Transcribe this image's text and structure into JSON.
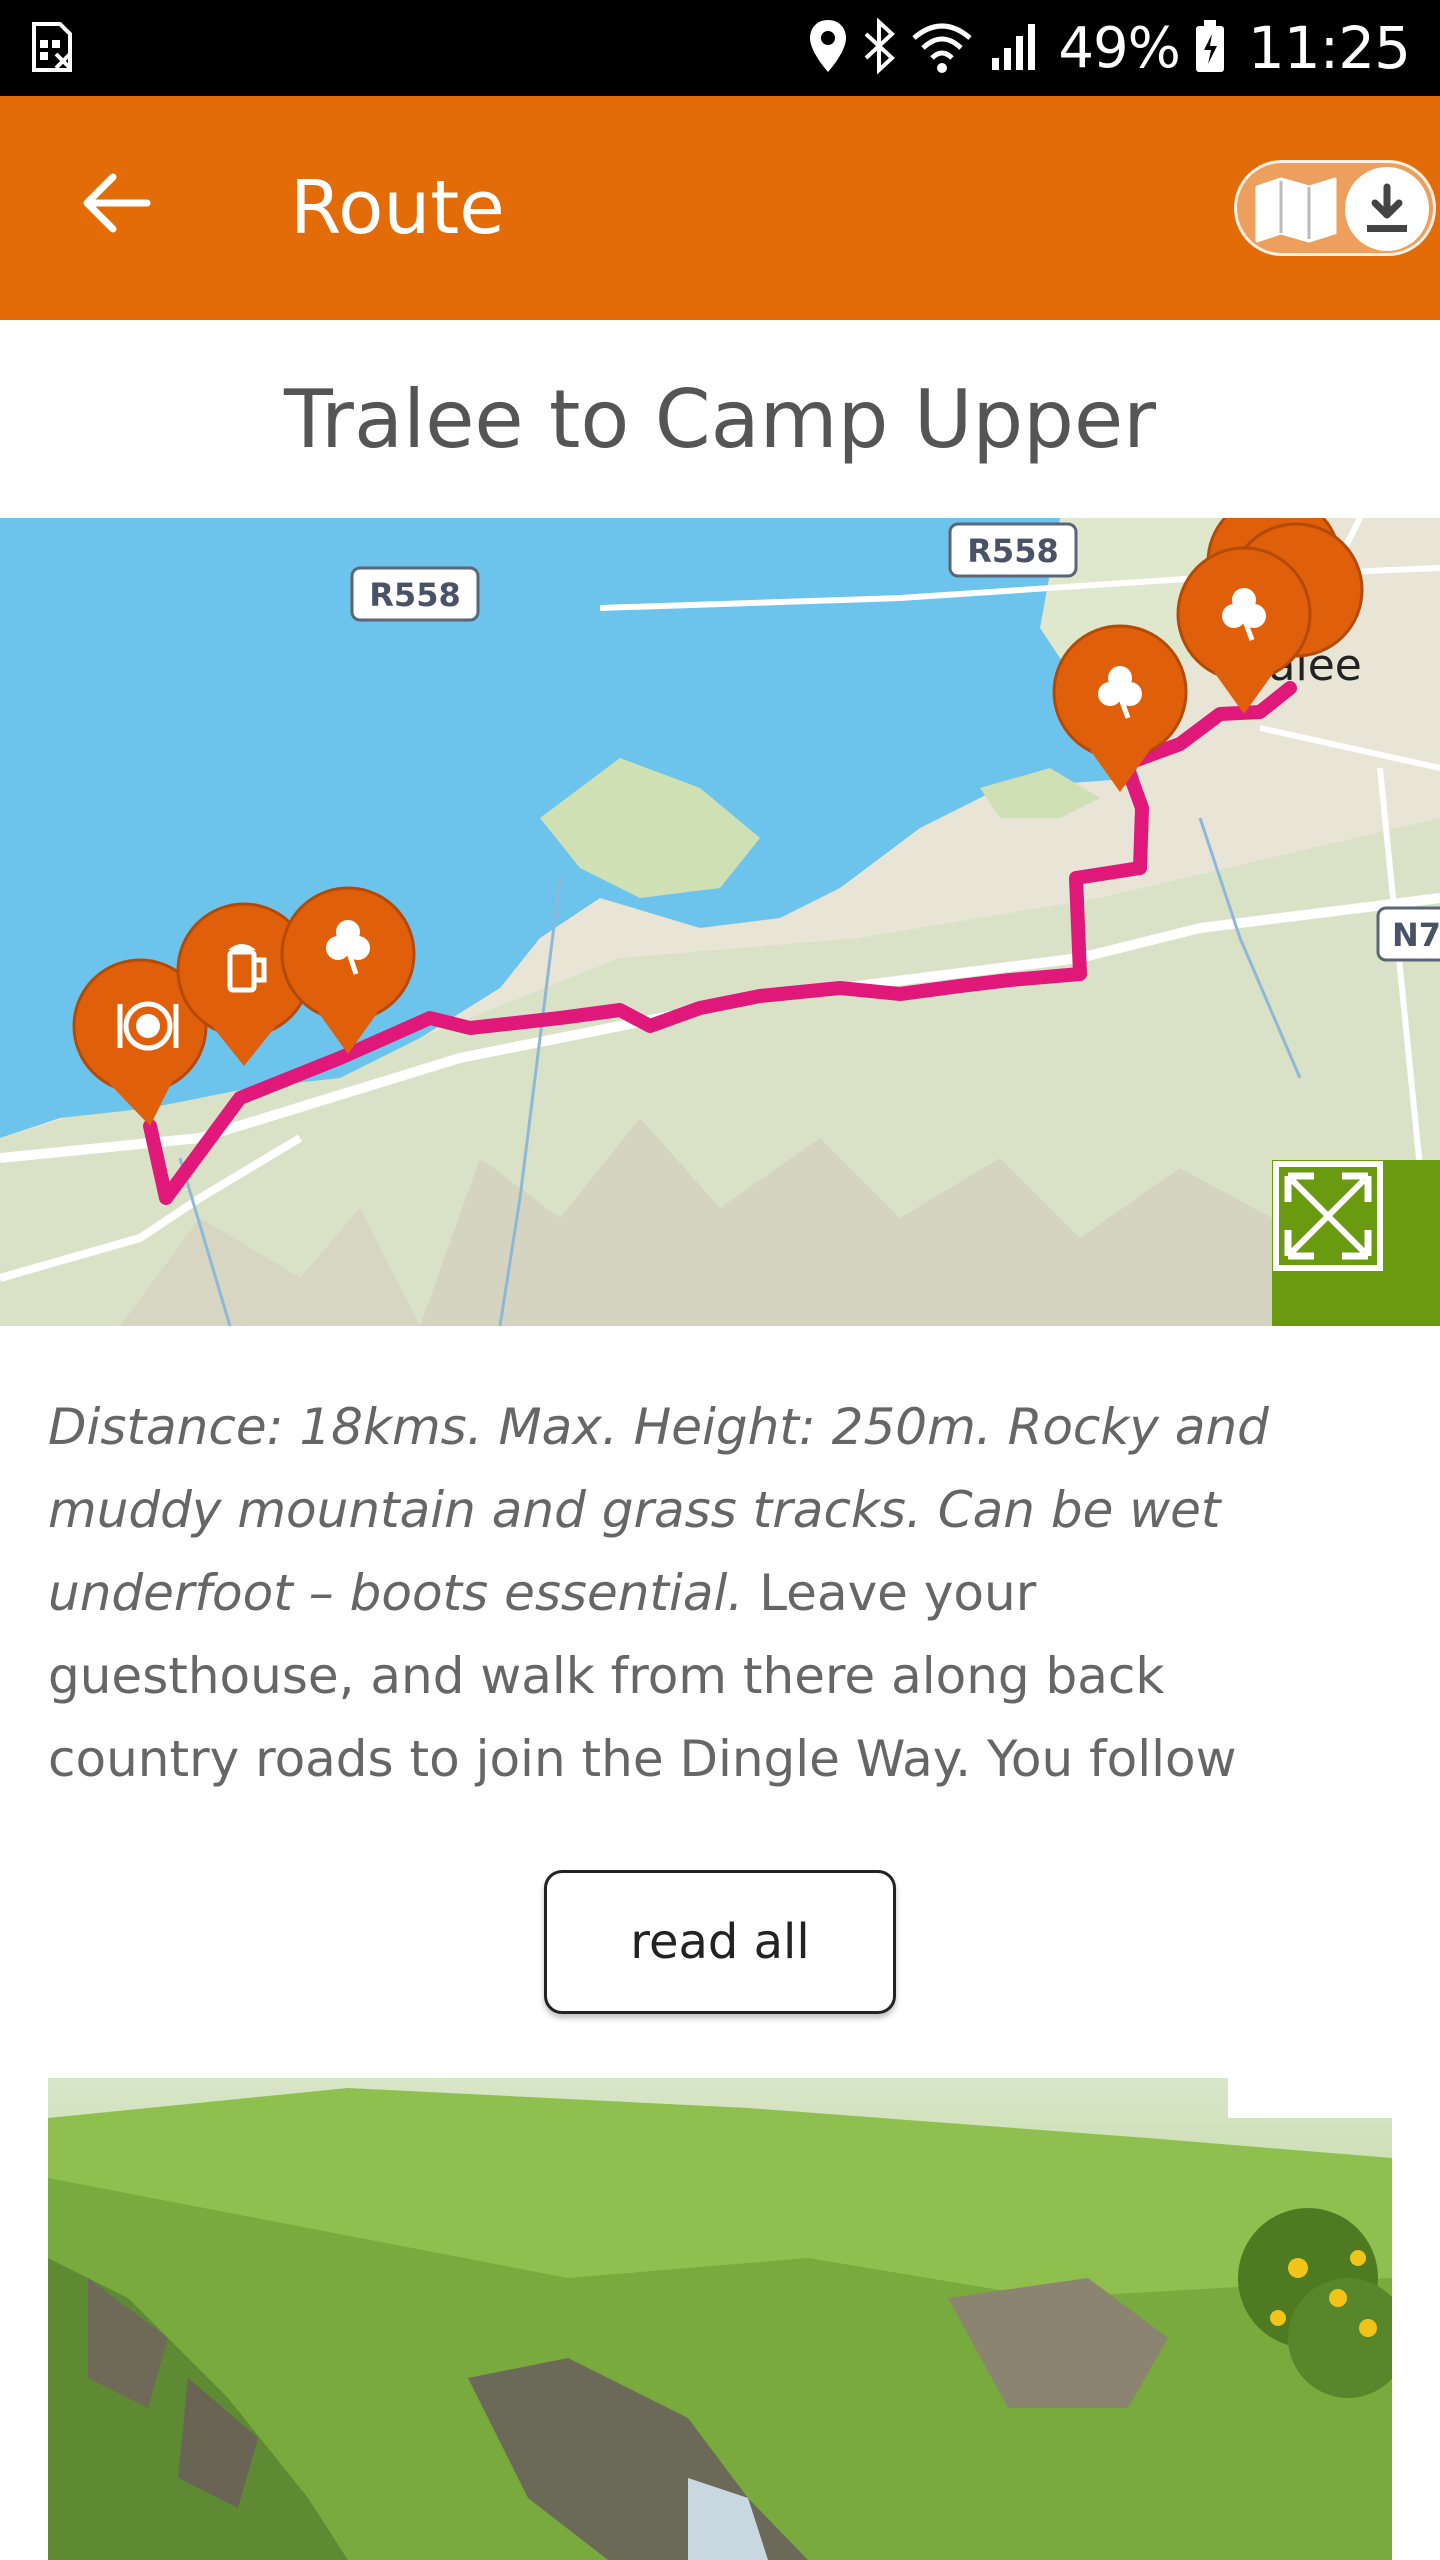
{
  "status_bar": {
    "battery": "49%",
    "time": "11:25"
  },
  "app_bar": {
    "title": "Route"
  },
  "route": {
    "title": "Tralee to Camp Upper",
    "description_italic": "Distance: 18kms. Max. Height: 250m. Rocky and muddy mountain and grass tracks. Can be wet underfoot – boots essential.",
    "description_plain": " Leave your guesthouse, and walk from there along back country roads to join the Dingle Way. You follow",
    "read_all_label": "read all"
  },
  "map": {
    "road_labels": [
      "R558",
      "R558",
      "N7"
    ],
    "town_label": "Tralee",
    "markers": [
      {
        "icon": "restaurant-icon"
      },
      {
        "icon": "beer-mug-icon"
      },
      {
        "icon": "shamrock-icon"
      },
      {
        "icon": "shamrock-icon"
      },
      {
        "icon": "shamrock-icon"
      }
    ],
    "colors": {
      "water": "#6cc4ec",
      "land": "#e6e2d4",
      "green": "#cfe0b4",
      "route": "#e0187a",
      "marker": "#df5f0b"
    }
  },
  "colors": {
    "app_bar": "#e36c09",
    "fullscreen_button": "#6a9a10"
  }
}
